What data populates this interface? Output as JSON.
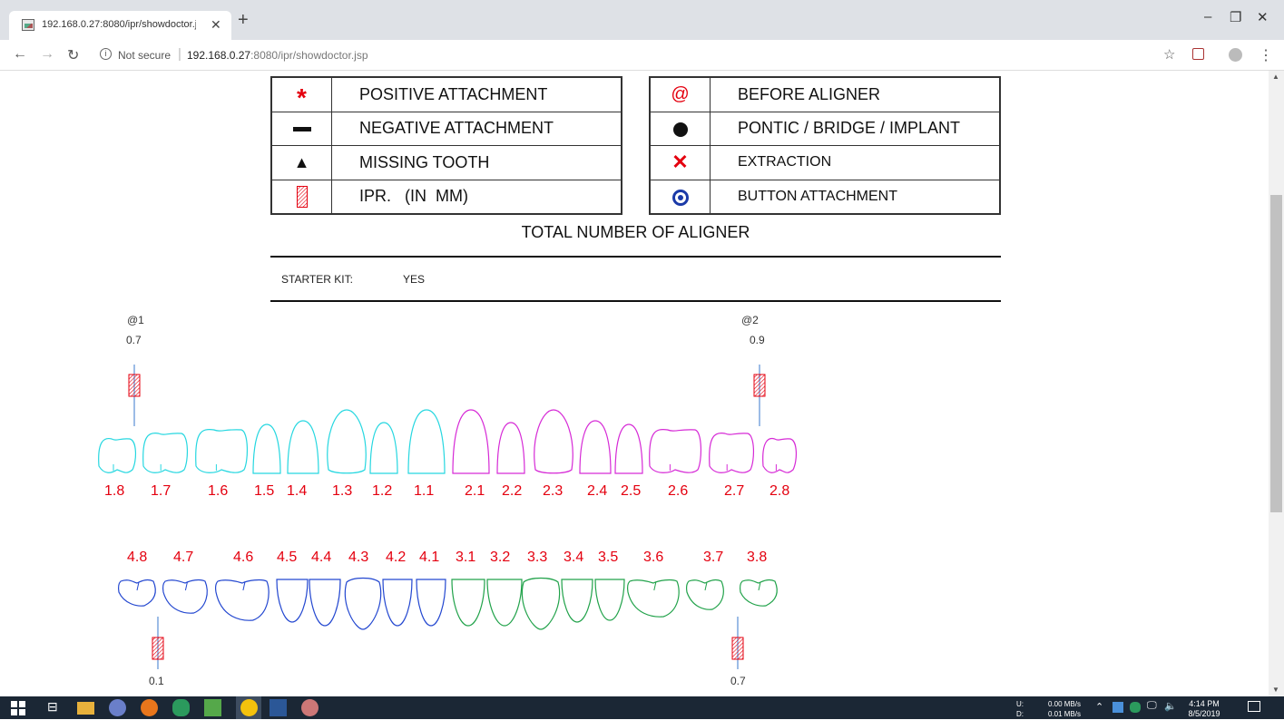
{
  "browser": {
    "tab_title": "192.168.0.27:8080/ipr/showdoctor.jsp",
    "security_label": "Not secure",
    "url_host": "192.168.0.27",
    "url_path": ":8080/ipr/showdoctor.jsp"
  },
  "legend_left": [
    {
      "icon": "asterisk-icon",
      "label": "POSITIVE ATTACHMENT"
    },
    {
      "icon": "dash-icon",
      "label": "NEGATIVE ATTACHMENT"
    },
    {
      "icon": "triangle-icon",
      "label": "MISSING TOOTH"
    },
    {
      "icon": "ipr-hatch-icon",
      "label": "IPR.   (IN  MM)"
    }
  ],
  "legend_right": [
    {
      "icon": "at-icon",
      "label": "BEFORE ALIGNER"
    },
    {
      "icon": "dot-icon",
      "label": "PONTIC / BRIDGE / IMPLANT"
    },
    {
      "icon": "x-icon",
      "label": "EXTRACTION"
    },
    {
      "icon": "button-attachment-icon",
      "label": "BUTTON ATTACHMENT"
    }
  ],
  "total_aligner_title": "TOTAL NUMBER OF ALIGNER",
  "starter_kit": {
    "label": "STARTER KIT:",
    "value": "YES"
  },
  "upper_teeth": {
    "numbers": [
      "1.8",
      "1.7",
      "1.6",
      "1.5",
      "1.4",
      "1.3",
      "1.2",
      "1.1",
      "2.1",
      "2.2",
      "2.3",
      "2.4",
      "2.5",
      "2.6",
      "2.7",
      "2.8"
    ],
    "right_color": "#26d7e0",
    "left_color": "#d62ad6"
  },
  "lower_teeth": {
    "numbers": [
      "4.8",
      "4.7",
      "4.6",
      "4.5",
      "4.4",
      "4.3",
      "4.2",
      "4.1",
      "3.1",
      "3.2",
      "3.3",
      "3.4",
      "3.5",
      "3.6",
      "3.7",
      "3.8"
    ],
    "right_color": "#2347d0",
    "left_color": "#21a24a"
  },
  "annotations": {
    "upper_left_before": "@1",
    "upper_left_ipr": "0.7",
    "upper_right_before": "@2",
    "upper_right_ipr": "0.9",
    "lower_left_ipr": "0.1",
    "lower_right_ipr": "0.7"
  },
  "taskbar": {
    "upload_label": "U:",
    "download_label": "D:",
    "upload_rate": "0.00 MB/s",
    "download_rate": "0.01 MB/s",
    "time": "4:14 PM",
    "date": "8/5/2019"
  },
  "colors": {
    "ipr_red": "#e4000f",
    "number_red": "#e4000f"
  }
}
